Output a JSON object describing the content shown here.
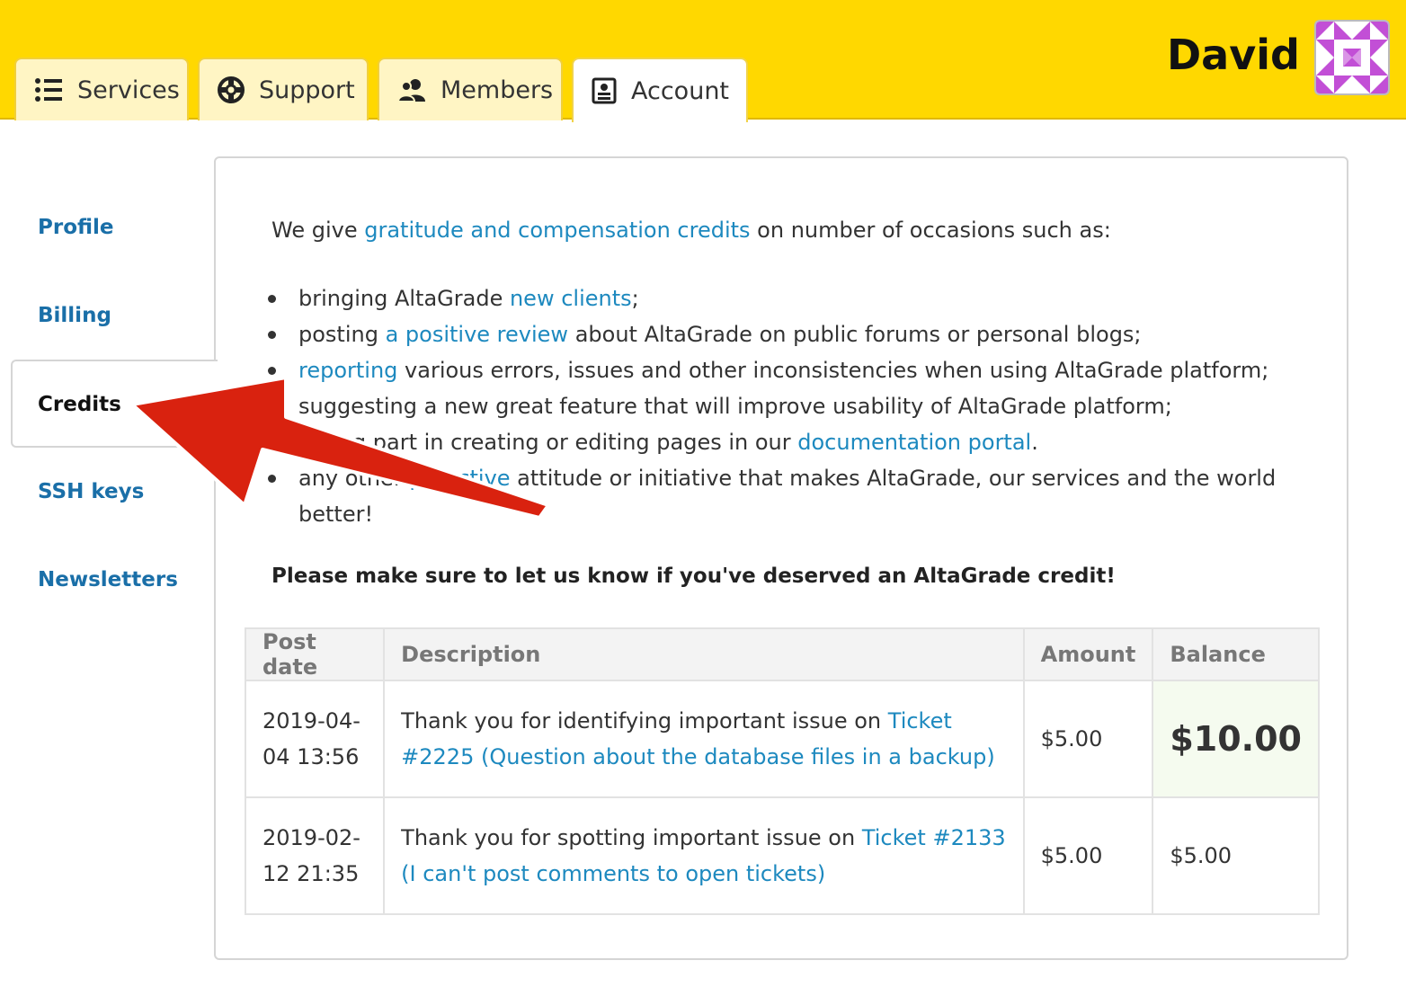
{
  "header": {
    "tabs": [
      {
        "label": "Services",
        "icon": "list-icon"
      },
      {
        "label": "Support",
        "icon": "lifebuoy-icon"
      },
      {
        "label": "Members",
        "icon": "users-icon"
      },
      {
        "label": "Account",
        "icon": "id-card-icon"
      }
    ],
    "active_tab": "Account",
    "user_name": "David"
  },
  "sidebar": {
    "items": [
      {
        "label": "Profile"
      },
      {
        "label": "Billing"
      },
      {
        "label": "Credits"
      },
      {
        "label": "SSH keys"
      },
      {
        "label": "Newsletters"
      }
    ],
    "active": "Credits"
  },
  "content": {
    "intro_prefix": "We give ",
    "intro_link": "gratitude and compensation credits",
    "intro_suffix": " on number of occasions such as:",
    "occasions": [
      {
        "pre": "bringing AltaGrade ",
        "link": "new clients",
        "post": ";"
      },
      {
        "pre": "posting ",
        "link": "a positive review",
        "post": " about AltaGrade on public forums or personal blogs;"
      },
      {
        "pre": "",
        "link": "reporting",
        "post": " various errors, issues and other inconsistencies when using AltaGrade platform;"
      },
      {
        "pre": "suggesting a new great feature that will improve usability of AltaGrade platform;",
        "link": "",
        "post": ""
      },
      {
        "pre": "taking part in creating or editing pages in our ",
        "link": "documentation portal",
        "post": "."
      },
      {
        "pre": "any other ",
        "link": "proactive",
        "post": " attitude or initiative that makes AltaGrade, our services and the world better!"
      }
    ],
    "notice": "Please make sure to let us know if you've deserved an AltaGrade credit!"
  },
  "table": {
    "headers": [
      "Post date",
      "Description",
      "Amount",
      "Balance"
    ],
    "rows": [
      {
        "date": "2019-04-04 13:56",
        "desc_text": "Thank you for identifying important issue on ",
        "desc_link": "Ticket #2225 (Question about the database files in a backup)",
        "amount": "$5.00",
        "balance": "$10.00"
      },
      {
        "date": "2019-02-12 21:35",
        "desc_text": "Thank you for spotting important issue on ",
        "desc_link": "Ticket #2133 (I can't post comments to open tickets)",
        "amount": "$5.00",
        "balance": "$5.00"
      }
    ]
  },
  "colors": {
    "header_bg": "#ffd800",
    "link": "#1d89bf",
    "sidebar_link": "#1a6fa8",
    "arrow": "#d9220f"
  }
}
